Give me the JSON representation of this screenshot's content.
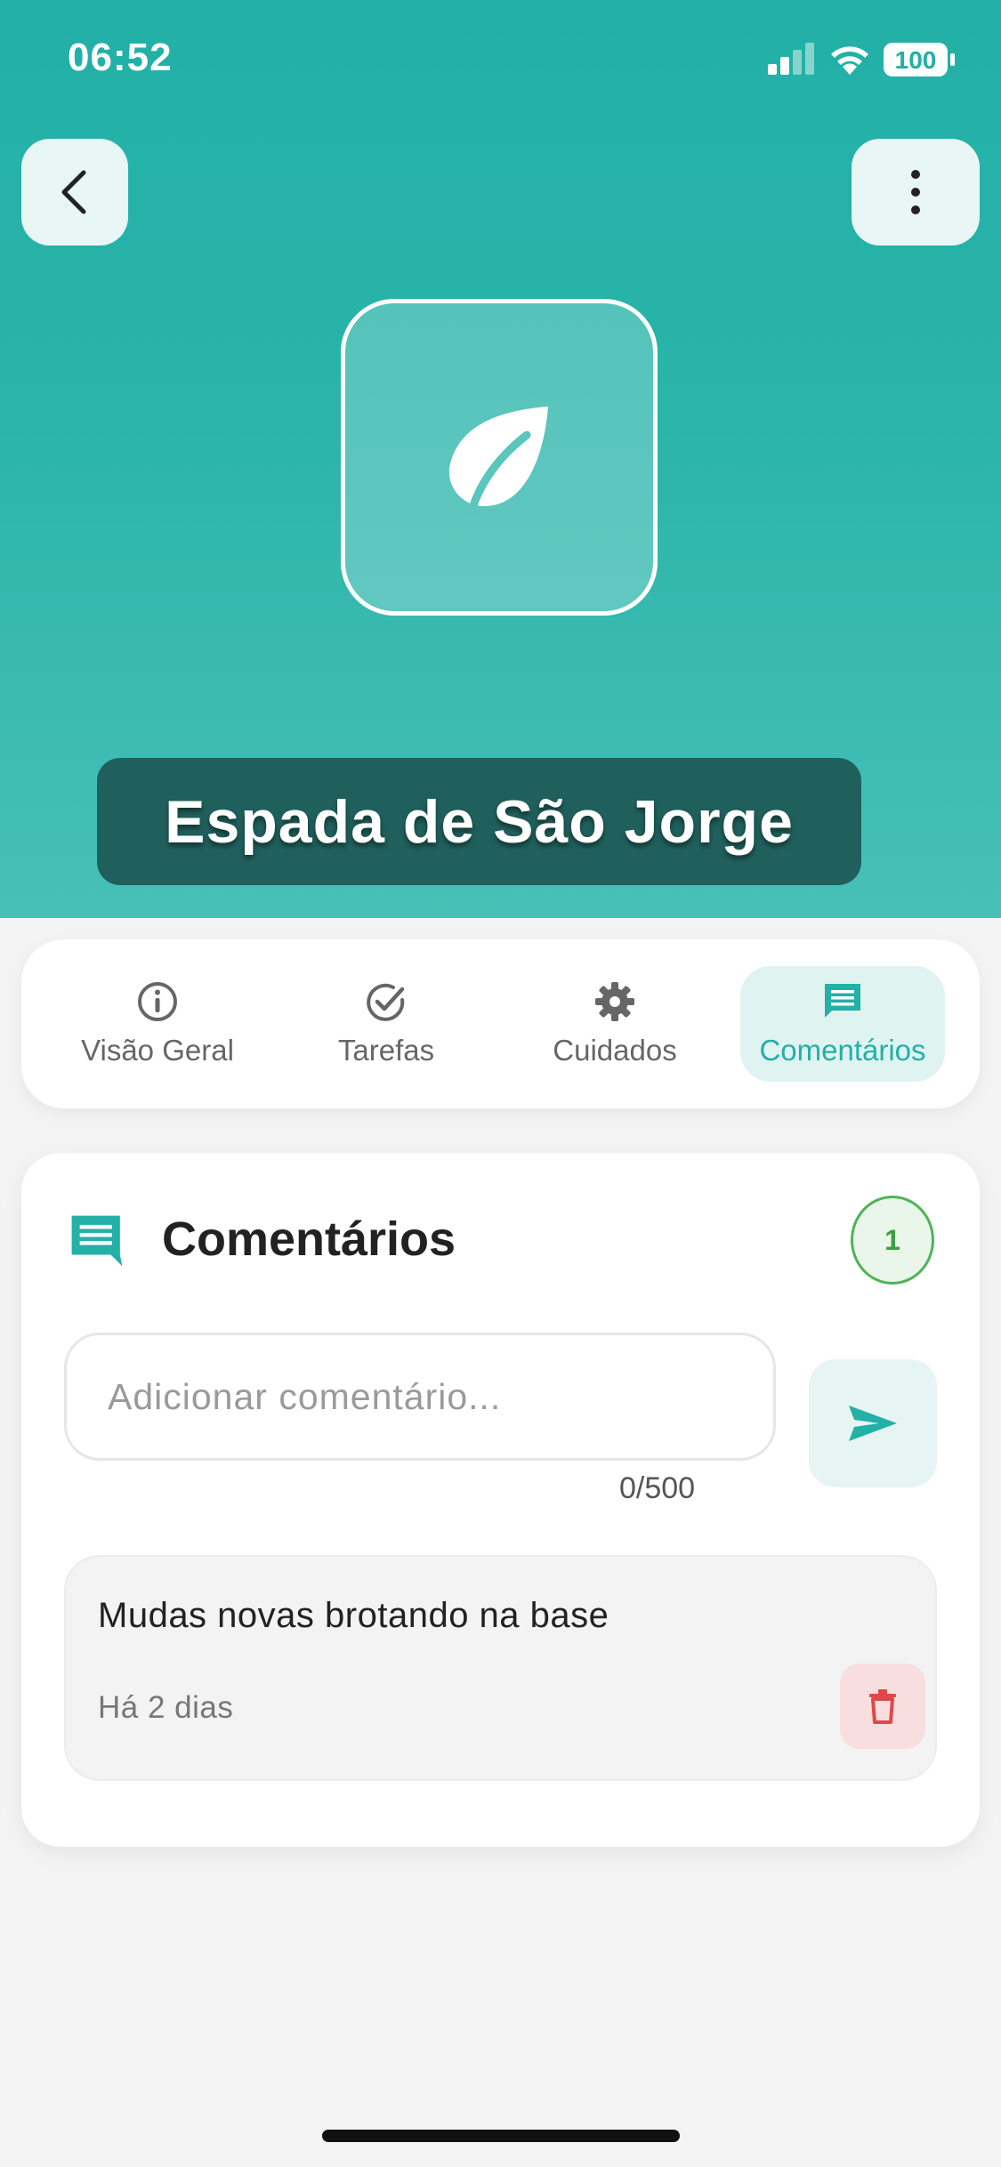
{
  "status_bar": {
    "time": "06:52",
    "battery": "100",
    "icons": [
      "signal-icon",
      "wifi-icon",
      "battery-icon"
    ]
  },
  "header": {
    "back_icon": "chevron-left-icon",
    "more_icon": "more-vertical-icon",
    "plant_icon": "leaf-icon",
    "plant_name": "Espada de São Jorge",
    "colors": {
      "primary": "#22b0a6",
      "name_box": "#20605c"
    }
  },
  "tabs": [
    {
      "label": "Visão Geral",
      "icon": "info-icon",
      "active": false
    },
    {
      "label": "Tarefas",
      "icon": "check-circle-icon",
      "active": false
    },
    {
      "label": "Cuidados",
      "icon": "gear-icon",
      "active": false
    },
    {
      "label": "Comentários",
      "icon": "comment-icon",
      "active": true
    }
  ],
  "comments_card": {
    "title": "Comentários",
    "count": "1",
    "input_placeholder": "Adicionar comentário...",
    "input_value": "",
    "char_count": "0/500",
    "send_icon": "send-icon",
    "items": [
      {
        "text": "Mudas novas brotando na base",
        "time": "Há 2 dias",
        "delete_icon": "trash-icon"
      }
    ]
  }
}
